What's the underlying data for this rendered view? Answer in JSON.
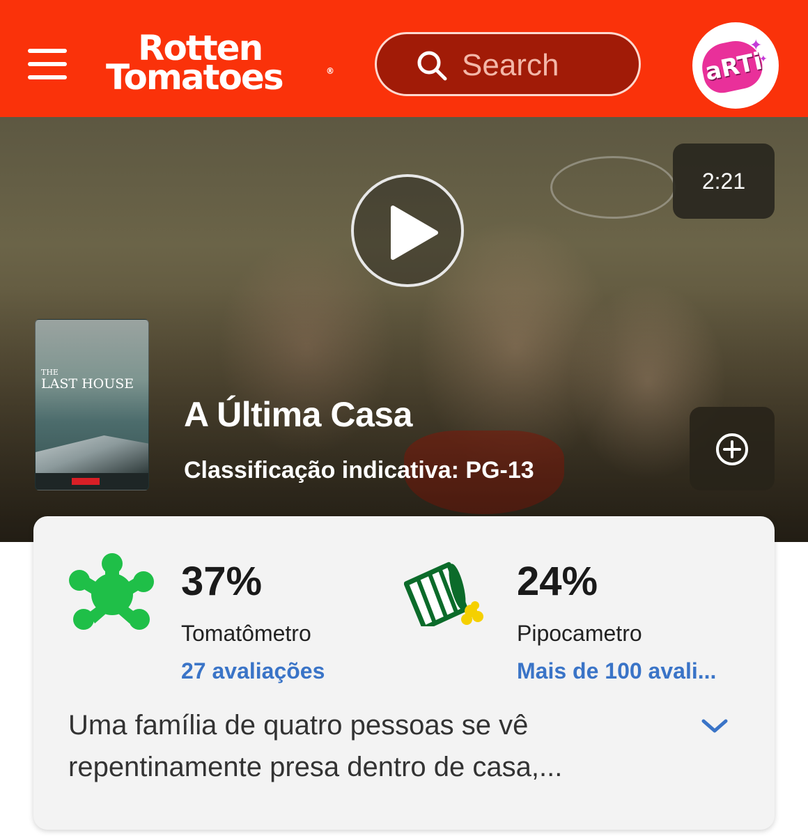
{
  "header": {
    "menu_icon": "hamburger-menu-icon",
    "logo_line1": "Rotten",
    "logo_line2": "Tomatoes",
    "logo_registered": "®",
    "search_placeholder": "Search",
    "avatar_text": "aRTi",
    "brand_color": "#fa320a"
  },
  "hero": {
    "duration": "2:21",
    "play_icon": "play-icon",
    "poster": {
      "title_small": "THE",
      "title": "LAST HOUSE"
    },
    "movie_title": "A Última Casa",
    "rating": "Classificação indicativa: PG-13",
    "add_icon": "plus-circle-icon"
  },
  "scores": {
    "tomatometer": {
      "value": "37%",
      "label": "Tomatômetro",
      "reviews": "27 avaliações",
      "icon": "green-splat-icon"
    },
    "popcornmeter": {
      "value": "24%",
      "label": "Pipocametro",
      "reviews": "Mais de 100 avali...",
      "icon": "tipped-popcorn-bucket-icon"
    },
    "link_color": "#3a74c7"
  },
  "synopsis": {
    "text": "Uma família de quatro pessoas se vê repentinamente presa dentro de casa,...",
    "expand_icon": "chevron-down-icon"
  }
}
